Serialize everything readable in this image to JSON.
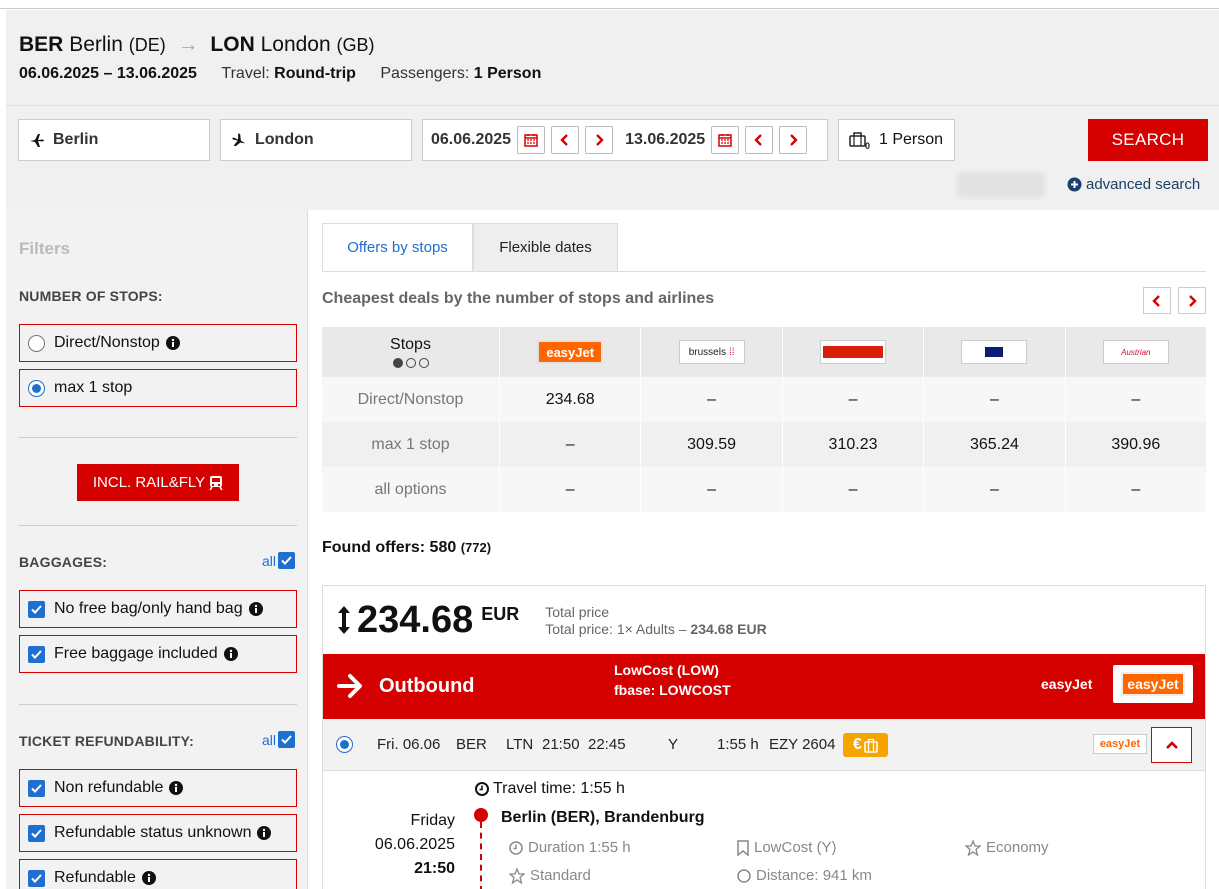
{
  "header": {
    "origin_code": "BER",
    "origin_city": "Berlin",
    "origin_country": "(DE)",
    "dest_code": "LON",
    "dest_city": "London",
    "dest_country": "(GB)",
    "dates": "06.06.2025 – 13.06.2025",
    "travel_label": "Travel:",
    "travel_value": "Round-trip",
    "passengers_label": "Passengers:",
    "passengers_value": "1 Person"
  },
  "search": {
    "from_value": "Berlin",
    "to_value": "London",
    "depart_date": "06.06.2025",
    "return_date": "13.06.2025",
    "persons": "1 Person",
    "search_label": "SEARCH",
    "advanced_label": "advanced search"
  },
  "filters": {
    "title": "Filters",
    "stops_heading": "NUMBER OF STOPS:",
    "stops_options": [
      "Direct/Nonstop",
      "max 1 stop"
    ],
    "rail_fly_label": "INCL. RAIL&FLY",
    "baggage_heading": "BAGGAGES:",
    "all_label": "all",
    "baggage_options": [
      "No free bag/only hand bag",
      "Free baggage included"
    ],
    "refund_heading": "TICKET REFUNDABILITY:",
    "refund_options": [
      "Non refundable",
      "Refundable status unknown",
      "Refundable"
    ]
  },
  "tabs": {
    "offers_by_stops": "Offers by stops",
    "flexible_dates": "Flexible dates"
  },
  "matrix": {
    "title": "Cheapest deals by the number of stops and airlines",
    "stops_header": "Stops",
    "airlines": [
      "easyJet",
      "brussels",
      "norwegian",
      "SAS",
      "Austrian"
    ],
    "rows": [
      {
        "label": "Direct/Nonstop",
        "values": [
          "234.68",
          "–",
          "–",
          "–",
          "–"
        ]
      },
      {
        "label": "max 1 stop",
        "values": [
          "–",
          "309.59",
          "310.23",
          "365.24",
          "390.96"
        ]
      },
      {
        "label": "all options",
        "values": [
          "–",
          "–",
          "–",
          "–",
          "–"
        ]
      }
    ]
  },
  "results": {
    "found_label": "Found offers:",
    "found_count": "580",
    "found_total": "(772)"
  },
  "offer": {
    "price": "234.68",
    "currency": "EUR",
    "total_label": "Total price",
    "total_detail_prefix": "Total price: 1× Adults –",
    "total_detail_value": "234.68 EUR",
    "outbound_label": "Outbound",
    "fare_line1": "LowCost (LOW)",
    "fare_line2": "fbase: LOWCOST",
    "airline": "easyJet",
    "airline_logo": "easyJet",
    "segment": {
      "date": "Fri. 06.06",
      "from": "BER",
      "to": "LTN",
      "dep": "21:50",
      "arr": "22:45",
      "class": "Y",
      "duration": "1:55 h",
      "flight": "EZY 2604"
    },
    "detail": {
      "travel_time": "Travel time: 1:55 h",
      "weekday": "Friday",
      "date": "06.06.2025",
      "time": "21:50",
      "airport": "Berlin (BER), Brandenburg",
      "duration": "Duration 1:55 h",
      "fare": "LowCost (Y)",
      "cabin": "Economy",
      "extra1": "Standard",
      "extra2": "Distance: 941 km"
    }
  },
  "colors": {
    "brand_red": "#d50000",
    "accent_blue": "#1e6fd0",
    "easyjet_orange": "#ff6600",
    "badge_orange": "#f5a400"
  }
}
